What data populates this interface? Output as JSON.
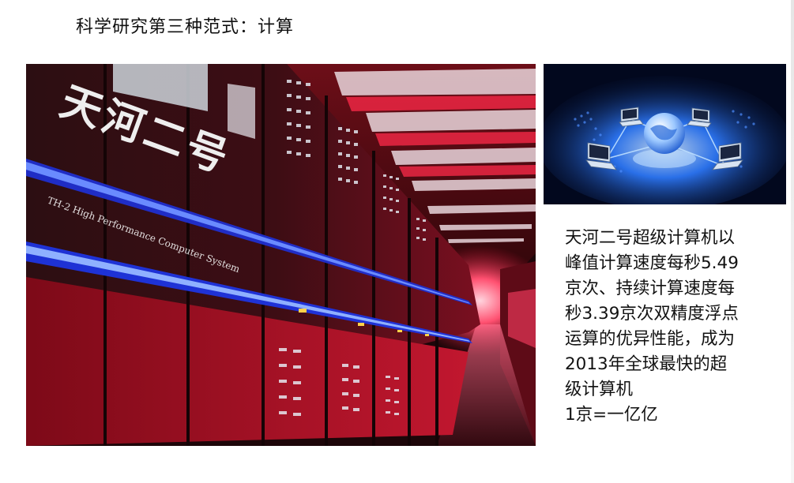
{
  "slide": {
    "title": "科学研究第三种范式：计算",
    "photo": {
      "sign_text": "天河二号",
      "sign_subtitle": "TH-2 High Performance Computer System"
    },
    "description_lines": [
      "天河二号超级计算机以",
      "峰值计算速度每秒5.49",
      "京次、持续计算速度每",
      "秒3.39京次双精度浮点",
      "运算的优异性能，成为",
      "2013年全球最快的超",
      "级计算机",
      "1京=一亿亿"
    ]
  },
  "colors": {
    "cabinet_red": "#b0142a",
    "led_blue": "#3b5bff",
    "network_blue": "#2e7bff"
  }
}
